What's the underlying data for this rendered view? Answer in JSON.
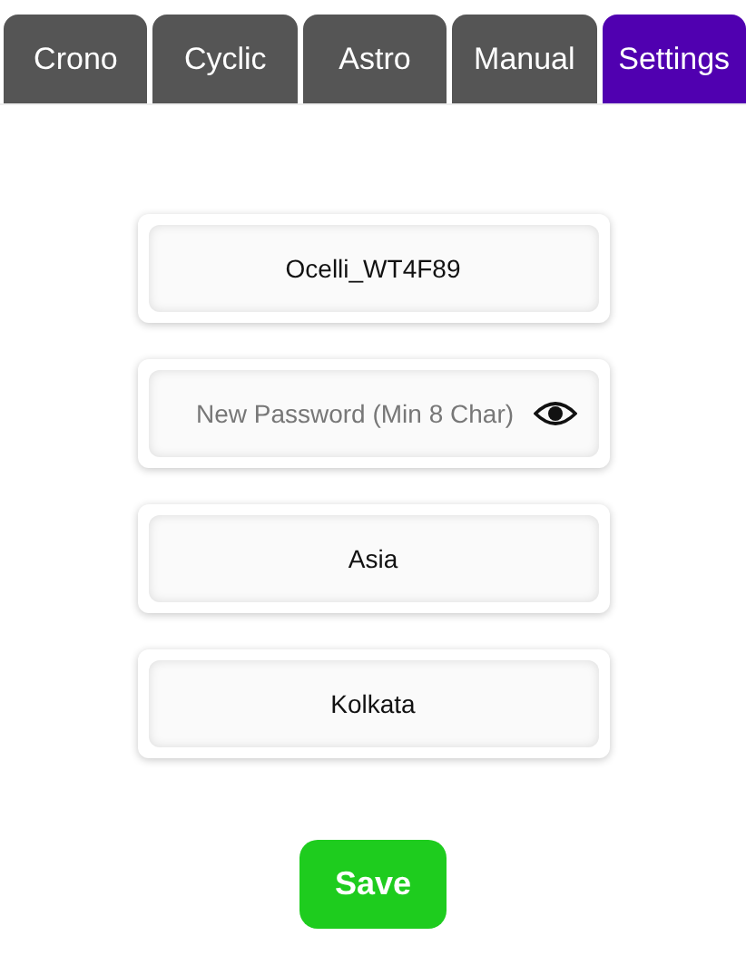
{
  "tabs": [
    {
      "label": "Crono",
      "selected": false
    },
    {
      "label": "Cyclic",
      "selected": false
    },
    {
      "label": "Astro",
      "selected": false
    },
    {
      "label": "Manual",
      "selected": false
    },
    {
      "label": "Settings",
      "selected": true
    }
  ],
  "fields": [
    {
      "kind": "text",
      "value": "Ocelli_WT4F89"
    },
    {
      "kind": "password",
      "placeholder": "New Password (Min 8 Char)"
    },
    {
      "kind": "text",
      "value": "Asia"
    },
    {
      "kind": "text",
      "value": "Kolkata"
    }
  ],
  "save_button": "Save"
}
